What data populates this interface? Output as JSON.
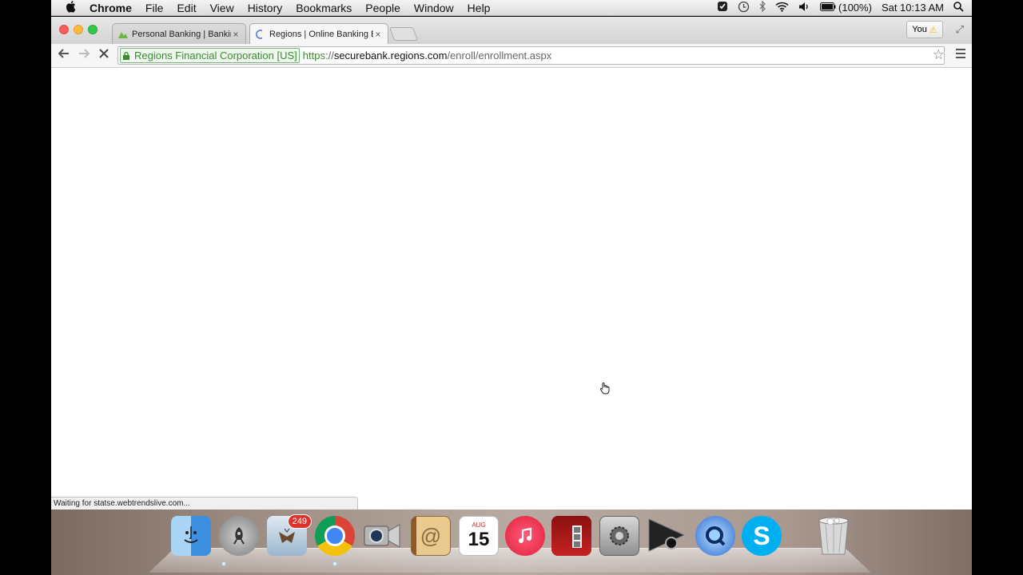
{
  "menubar": {
    "app_name": "Chrome",
    "menus": [
      "File",
      "Edit",
      "View",
      "History",
      "Bookmarks",
      "People",
      "Window",
      "Help"
    ],
    "battery": "(100%)",
    "clock": "Sat 10:13 AM"
  },
  "tabs": [
    {
      "title": "Personal Banking | Banking",
      "active": false
    },
    {
      "title": "Regions | Online Banking E",
      "active": true
    }
  ],
  "profile": {
    "label": "You",
    "warning_icon": "warning-icon"
  },
  "omnibox": {
    "ev_label": "Regions Financial Corporation [US]",
    "url_scheme": "https",
    "url_separator": "://",
    "url_host": "securebank.regions.com",
    "url_path": "/enroll/enrollment.aspx"
  },
  "status_bar": {
    "text": "Waiting for statse.webtrendslive.com..."
  },
  "dock": {
    "mail_badge": "249",
    "calendar_month": "AUG",
    "calendar_day": "15",
    "items": [
      "finder-icon",
      "launchpad-icon",
      "mail-icon",
      "chrome-icon",
      "facetime-icon",
      "contacts-icon",
      "calendar-icon",
      "itunes-icon",
      "photo-booth-icon",
      "system-preferences-icon",
      "screen-recorder-icon",
      "quicktime-icon",
      "skype-icon",
      "trash-icon"
    ]
  },
  "colors": {
    "ev_green": "#3c8a2e",
    "badge_red": "#e0322b"
  }
}
